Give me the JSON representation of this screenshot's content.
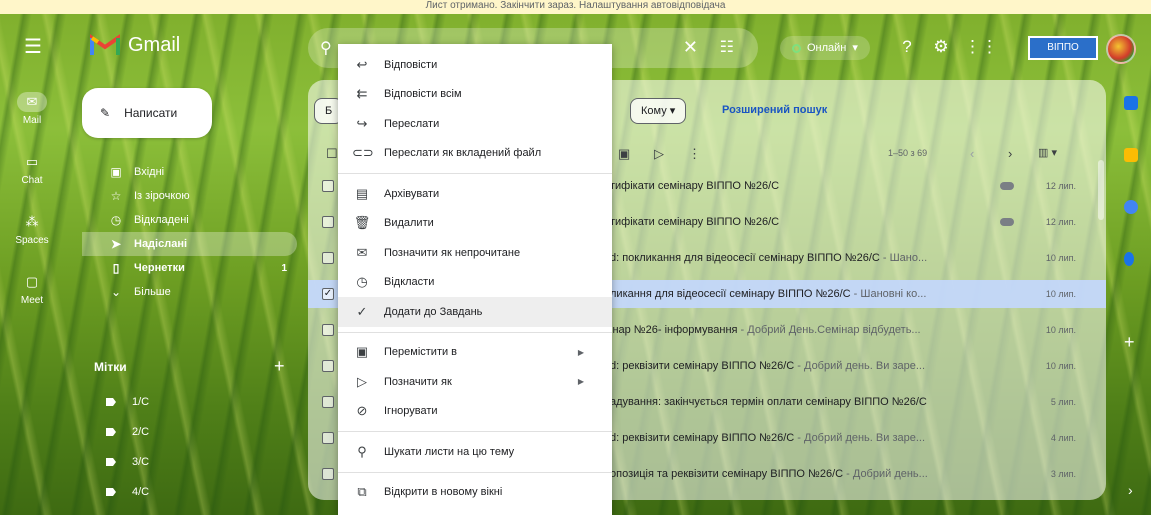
{
  "notice": "Лист отримано. Закінчити зараз. Налаштування автовідповідача",
  "header": {
    "logo_text": "Gmail",
    "status_label": "Онлайн",
    "org_badge": "ВІППО"
  },
  "rail": [
    {
      "label": "Mail",
      "icon": "mail-icon"
    },
    {
      "label": "Chat",
      "icon": "chat-icon"
    },
    {
      "label": "Spaces",
      "icon": "spaces-icon"
    },
    {
      "label": "Meet",
      "icon": "meet-icon"
    }
  ],
  "compose_label": "Написати",
  "nav": [
    {
      "label": "Вхідні",
      "icon": "inbox-icon"
    },
    {
      "label": "Із зірочкою",
      "icon": "star-icon"
    },
    {
      "label": "Відкладені",
      "icon": "clock-icon"
    },
    {
      "label": "Надіслані",
      "icon": "send-icon"
    },
    {
      "label": "Чернетки",
      "icon": "draft-icon",
      "count": "1"
    },
    {
      "label": "Більше",
      "icon": "chevron-down-icon"
    }
  ],
  "labels": {
    "header": "Мітки",
    "items": [
      "1/С",
      "2/С",
      "3/С",
      "4/С"
    ]
  },
  "filters": {
    "chip1": "Б",
    "chip_to": "Кому ▾",
    "advanced": "Розширений пошук"
  },
  "pager": "1–50 з 69",
  "emails": [
    {
      "subject": "тифікати семінару ВІППО №26/С",
      "snippet": "",
      "date": "12 лип.",
      "attach": true
    },
    {
      "subject": "тифікати семінару ВІППО №26/С",
      "snippet": "",
      "date": "12 лип.",
      "attach": true
    },
    {
      "subject": "d: покликання для відеосесії семінару ВІППО №26/С",
      "snippet": " - Шано...",
      "date": "10 лип.",
      "attach": false
    },
    {
      "subject": "ликання для відеосесії семінару ВІППО №26/С",
      "snippet": " - Шановні ко...",
      "date": "10 лип.",
      "attach": false
    },
    {
      "subject": "інар №26- інформування",
      "snippet": " - Добрий День.Семінар відбудеть...",
      "date": "10 лип.",
      "attach": false
    },
    {
      "subject": "d: реквізити семінару ВІППО №26/С",
      "snippet": " - Добрий день. Ви заре...",
      "date": "10 лип.",
      "attach": false
    },
    {
      "subject": "адування: закінчується термін оплати семінару ВІППО №26/С",
      "snippet": "",
      "date": "5 лип.",
      "attach": false
    },
    {
      "subject": "d: реквізити семінару ВІППО №26/С",
      "snippet": " - Добрий день. Ви заре...",
      "date": "4 лип.",
      "attach": false
    },
    {
      "subject": "опозиція та реквізити семінару ВІППО №26/С",
      "snippet": " - Добрий день...",
      "date": "3 лип.",
      "attach": false
    }
  ],
  "context_menu": {
    "group1": [
      {
        "label": "Відповісти",
        "icon": "reply-icon"
      },
      {
        "label": "Відповісти всім",
        "icon": "reply-all-icon"
      },
      {
        "label": "Переслати",
        "icon": "forward-icon"
      },
      {
        "label": "Переслати як вкладений файл",
        "icon": "attachment-icon"
      }
    ],
    "group2": [
      {
        "label": "Архівувати",
        "icon": "archive-icon"
      },
      {
        "label": "Видалити",
        "icon": "trash-icon"
      },
      {
        "label": "Позначити як непрочитане",
        "icon": "mark-unread-icon"
      },
      {
        "label": "Відкласти",
        "icon": "snooze-icon"
      },
      {
        "label": "Додати до Завдань",
        "icon": "add-task-icon"
      }
    ],
    "group3": [
      {
        "label": "Перемістити в",
        "icon": "move-to-icon"
      },
      {
        "label": "Позначити як",
        "icon": "label-icon"
      },
      {
        "label": "Ігнорувати",
        "icon": "mute-icon"
      }
    ],
    "group4": [
      {
        "label": "Шукати листи на цю тему",
        "icon": "search-icon"
      }
    ],
    "group5": [
      {
        "label": "Відкрити в новому вікні",
        "icon": "open-new-window-icon"
      }
    ]
  },
  "colors": {
    "accent_blue": "#1a55c2",
    "selected_row": "#c3d7fa",
    "menu_hover": "#eeeeee"
  }
}
